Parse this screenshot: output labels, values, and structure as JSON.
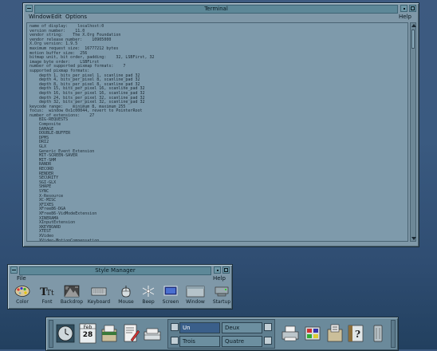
{
  "terminal": {
    "title": "Terminal",
    "menu": {
      "window": "Window",
      "edit": "Edit",
      "options": "Options",
      "help": "Help"
    },
    "lines": [
      "name of display:    localhost:0",
      "version number:    11.0",
      "vendor string:    The X.Org Foundation",
      "vendor release number:    10905000",
      "X.Org version: 1.9.5",
      "maximum request size:  16777212 bytes",
      "motion buffer size:  256",
      "bitmap unit, bit order, padding:    32, LSBFirst, 32",
      "image byte order:    LSBFirst",
      "number of supported pixmap formats:    7",
      "supported pixmap formats:",
      "    depth 1, bits_per_pixel 1, scanline_pad 32",
      "    depth 4, bits_per_pixel 8, scanline_pad 32",
      "    depth 8, bits_per_pixel 8, scanline_pad 32",
      "    depth 15, bits_per_pixel 16, scanline_pad 32",
      "    depth 16, bits_per_pixel 16, scanline_pad 32",
      "    depth 24, bits_per_pixel 32, scanline_pad 32",
      "    depth 32, bits_per_pixel 32, scanline_pad 32",
      "keycode range:    minimum 8, maximum 255",
      "focus:  window 0x1c00044, revert to PointerRoot",
      "number of extensions:    27",
      "    BIG-REQUESTS",
      "    Composite",
      "    DAMAGE",
      "    DOUBLE-BUFFER",
      "    DPMS",
      "    DRI2",
      "    GLX",
      "    Generic Event Extension",
      "    MIT-SCREEN-SAVER",
      "    MIT-SHM",
      "    RANDR",
      "    RECORD",
      "    RENDER",
      "    SECURITY",
      "    SGI-GLX",
      "    SHAPE",
      "    SYNC",
      "    X-Resource",
      "    XC-MISC",
      "    XFIXES",
      "    XFree86-DGA",
      "    XFree86-VidModeExtension",
      "    XINERAMA",
      "    XInputExtension",
      "    XKEYBOARD",
      "    XTEST",
      "    XVideo",
      "    XVideo-MotionCompensation"
    ]
  },
  "style_manager": {
    "title": "Style Manager",
    "menu": {
      "file": "File",
      "help": "Help"
    },
    "tools": [
      {
        "label": "Color",
        "icon": "palette-icon"
      },
      {
        "label": "Font",
        "icon": "font-icon"
      },
      {
        "label": "Backdrop",
        "icon": "backdrop-icon"
      },
      {
        "label": "Keyboard",
        "icon": "keyboard-icon"
      },
      {
        "label": "Mouse",
        "icon": "mouse-icon"
      },
      {
        "label": "Beep",
        "icon": "beep-icon"
      },
      {
        "label": "Screen",
        "icon": "screen-icon"
      },
      {
        "label": "Window",
        "icon": "window-icon"
      },
      {
        "label": "Startup",
        "icon": "startup-icon"
      }
    ]
  },
  "front_panel": {
    "calendar": {
      "month": "Feb",
      "day": "28"
    },
    "workspaces": [
      {
        "label": "Un",
        "active": true
      },
      {
        "label": "Deux",
        "active": false
      },
      {
        "label": "Trois",
        "active": false
      },
      {
        "label": "Quatre",
        "active": false
      }
    ],
    "left_icons": [
      "clock-icon",
      "calendar-icon",
      "file-manager-icon",
      "text-editor-icon",
      "mailer-icon"
    ],
    "right_icons": [
      "printer-icon",
      "style-manager-icon",
      "application-manager-icon",
      "help-icon",
      "trash-icon"
    ]
  }
}
